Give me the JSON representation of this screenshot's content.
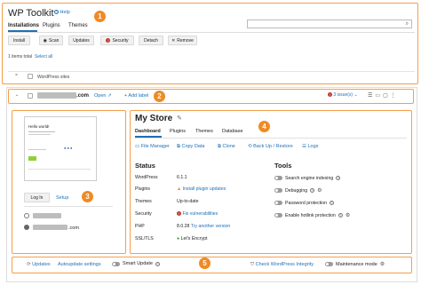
{
  "header": {
    "title": "WP Toolkit",
    "help_label": "Help",
    "tabs": [
      "Installations",
      "Plugins",
      "Themes"
    ],
    "toolbar": [
      "Install",
      "Scan",
      "Updates",
      "Security",
      "Detach",
      "Remove"
    ],
    "items_total": "1 items total",
    "select_all": "Select all",
    "wordpress_sites": "WordPress sites"
  },
  "site_bar": {
    "domain_suffix": ".com",
    "open_label": "Open",
    "add_label": "+ Add label",
    "issues": "3 issue(s)"
  },
  "preview": {
    "hello_text": "Hello world!",
    "login_label": "Log In",
    "setup_label": "Setup",
    "domain_suffix": ".com"
  },
  "store": {
    "title": "My Store",
    "tabs": [
      "Dashboard",
      "Plugins",
      "Themes",
      "Database"
    ],
    "actions": [
      "File Manager",
      "Copy Data",
      "Clone",
      "Back Up / Restore",
      "Logs"
    ],
    "status_heading": "Status",
    "status": [
      {
        "key": "WordPress",
        "value": "6.1.1"
      },
      {
        "key": "Plugins",
        "value": "Install plugin updates"
      },
      {
        "key": "Themes",
        "value": "Up-to-date"
      },
      {
        "key": "Security",
        "value": "Fix vulnerabilities"
      },
      {
        "key": "PHP",
        "value": "8.0.28",
        "extra": "Try another version"
      },
      {
        "key": "SSL/TLS",
        "value": "Let's Encrypt"
      }
    ],
    "tools_heading": "Tools",
    "tools": [
      "Search engine indexing",
      "Debugging",
      "Password protection",
      "Enable hotlink protection"
    ]
  },
  "footer": {
    "updates": "Updates",
    "autoupdate": "Autoupdate settings",
    "smart_update": "Smart Update",
    "check_integrity": "Check WordPress Integrity",
    "maintenance": "Maintenance mode"
  },
  "callouts": [
    "1",
    "2",
    "3",
    "4",
    "5"
  ],
  "colors": {
    "accent": "#f59e4a",
    "link": "#1f6fb5",
    "warning": "#e08a1e",
    "danger": "#c0392b"
  }
}
